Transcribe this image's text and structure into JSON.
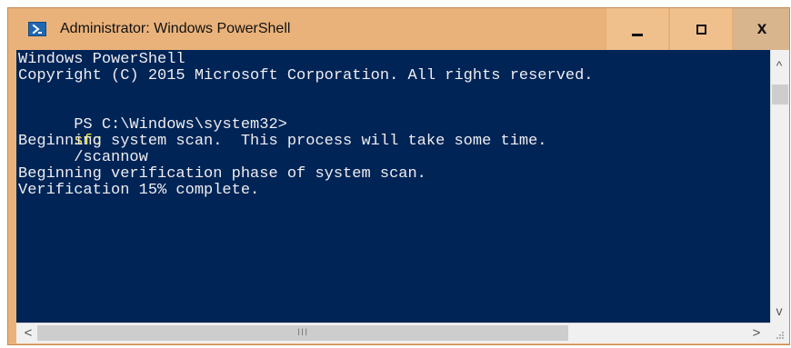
{
  "window": {
    "title": "Administrator: Windows PowerShell",
    "app_icon": "powershell-icon",
    "controls": {
      "minimize": "minimize-icon",
      "maximize": "maximize-icon",
      "close": "close-icon",
      "close_label": "x"
    }
  },
  "console": {
    "lines": {
      "header": "Windows PowerShell",
      "copyright": "Copyright (C) 2015 Microsoft Corporation. All rights reserved.",
      "prompt": "PS C:\\Windows\\system32>",
      "command_name": "sfc",
      "command_args": "/scannow",
      "scan_begin": "Beginning system scan.  This process will take some time.",
      "verification_begin": "Beginning verification phase of system scan.",
      "verification_progress": "Verification 15% complete."
    },
    "colors": {
      "background": "#012456",
      "text": "#eeedf0",
      "command": "#f5ef47"
    }
  },
  "scrollbars": {
    "vertical": {
      "up_icon": "scroll-up-icon",
      "up_glyph": "^",
      "down_icon": "scroll-down-icon",
      "down_glyph": "v"
    },
    "horizontal": {
      "left_icon": "scroll-left-icon",
      "left_glyph": "<",
      "right_icon": "scroll-right-icon",
      "right_glyph": ">",
      "grip_glyph": "III"
    }
  }
}
